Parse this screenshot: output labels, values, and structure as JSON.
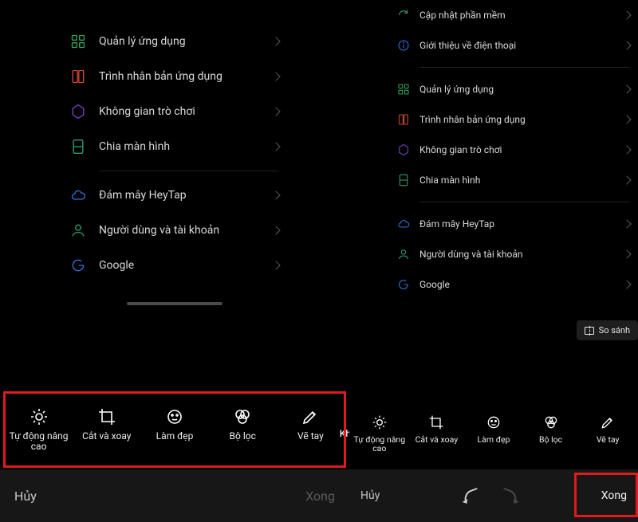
{
  "left": {
    "settings": [
      {
        "icon": "apps",
        "label": "Quản lý ứng dụng"
      },
      {
        "icon": "clone",
        "label": "Trình nhân bản ứng dụng"
      },
      {
        "icon": "game",
        "label": "Không gian trò chơi"
      },
      {
        "icon": "split",
        "label": "Chia màn hình"
      }
    ],
    "settings2": [
      {
        "icon": "cloud",
        "label": "Đám mây HeyTap"
      },
      {
        "icon": "user",
        "label": "Người dùng và tài khoản"
      },
      {
        "icon": "google",
        "label": "Google"
      }
    ],
    "toolbar": [
      {
        "icon": "auto",
        "label": "Tự động nâng cao"
      },
      {
        "icon": "crop",
        "label": "Cắt và xoay"
      },
      {
        "icon": "beauty",
        "label": "Làm đẹp"
      },
      {
        "icon": "filter",
        "label": "Bộ lọc"
      },
      {
        "icon": "draw",
        "label": "Vẽ tay"
      }
    ],
    "cutoff_label": "Kh",
    "cancel_label": "Hủy",
    "done_label": "Xong"
  },
  "right": {
    "settings_top": [
      {
        "icon": "update",
        "label": "Cập nhật phần mềm"
      },
      {
        "icon": "info",
        "label": "Giới thiệu về điện thoại"
      }
    ],
    "settings_mid": [
      {
        "icon": "apps",
        "label": "Quản lý ứng dụng"
      },
      {
        "icon": "clone",
        "label": "Trình nhân bản ứng dụng"
      },
      {
        "icon": "game",
        "label": "Không gian trò chơi"
      },
      {
        "icon": "split",
        "label": "Chia màn hình"
      }
    ],
    "settings_bot": [
      {
        "icon": "cloud",
        "label": "Đám mây HeyTap"
      },
      {
        "icon": "user",
        "label": "Người dùng và tài khoản"
      },
      {
        "icon": "google",
        "label": "Google"
      }
    ],
    "compare_label": "So sánh",
    "toolbar": [
      {
        "icon": "auto",
        "label": "Tự động nâng cao"
      },
      {
        "icon": "crop",
        "label": "Cắt và xoay"
      },
      {
        "icon": "beauty",
        "label": "Làm đẹp"
      },
      {
        "icon": "filter",
        "label": "Bộ lọc"
      },
      {
        "icon": "draw",
        "label": "Vẽ tay"
      }
    ],
    "cancel_label": "Hủy",
    "done_label": "Xong"
  },
  "icon_colors": {
    "apps": "#2fa85a",
    "clone": "#d64a2f",
    "game": "#7a3fbf",
    "split": "#2fa06a",
    "cloud": "#2f6fe0",
    "user": "#2fa06a",
    "google": "#3a6fe0",
    "update": "#2fa06a",
    "info": "#3a6fe0"
  }
}
